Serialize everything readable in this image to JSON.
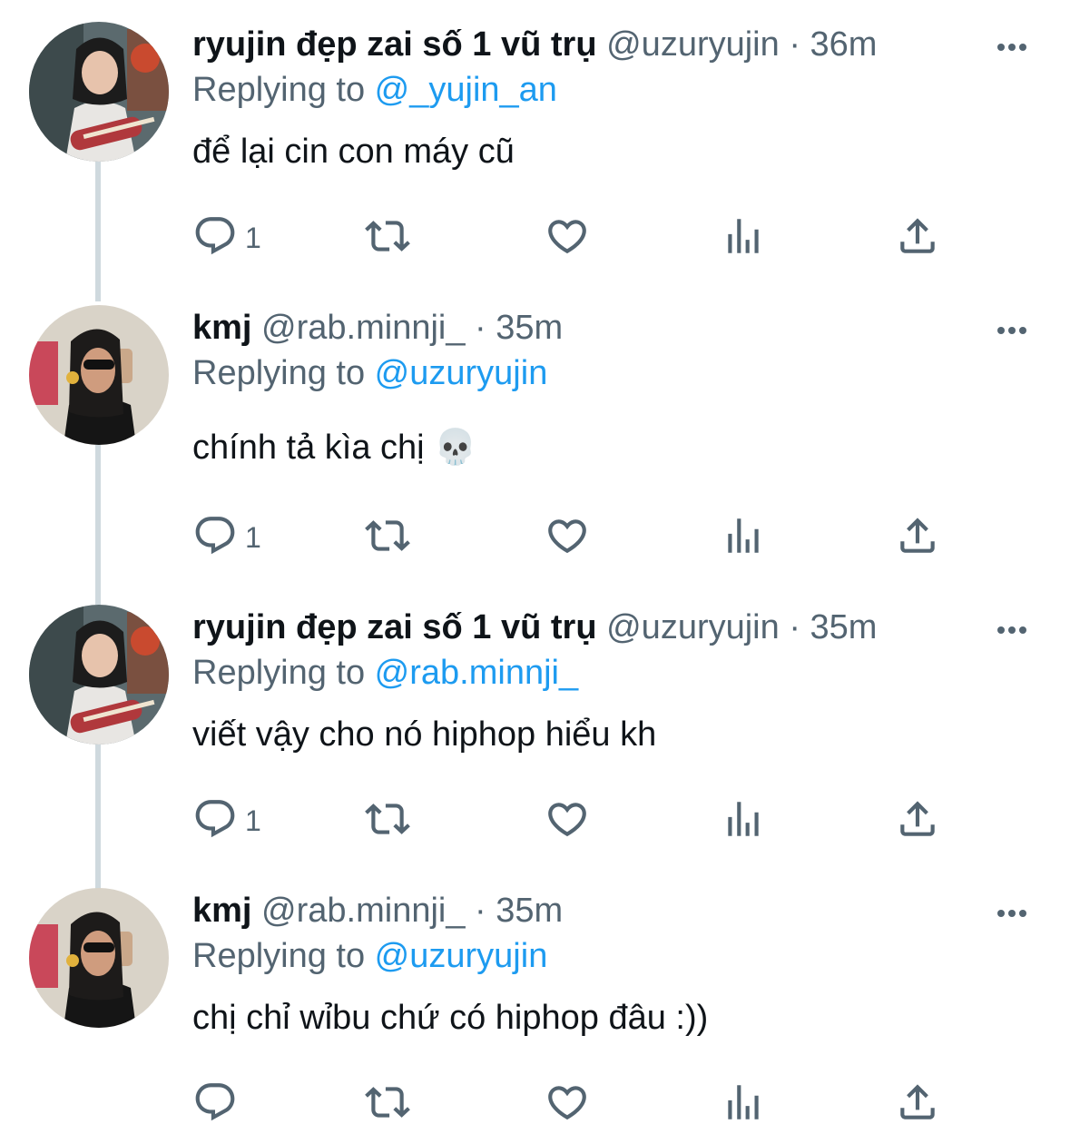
{
  "tweets": [
    {
      "name": "ryujin đẹp zai số 1 vũ trụ",
      "handle": "@uzuryujin",
      "time": "· 36m",
      "replying_prefix": "Replying to ",
      "replying_to": "@_yujin_an",
      "text": "để lại cin con máy cũ",
      "reply_count": "1",
      "avatar": "guitar-girl-avatar"
    },
    {
      "name": "kmj",
      "handle": "@rab.minnji_",
      "time": "· 35m",
      "replying_prefix": "Replying to ",
      "replying_to": "@uzuryujin",
      "text": "chính tả kìa chị 💀",
      "reply_count": "1",
      "avatar": "selfie-girl-avatar"
    },
    {
      "name": "ryujin đẹp zai số 1 vũ trụ",
      "handle": "@uzuryujin",
      "time": "· 35m",
      "replying_prefix": "Replying to ",
      "replying_to": "@rab.minnji_",
      "text": "viết vậy cho nó hiphop hiểu kh",
      "reply_count": "1",
      "avatar": "guitar-girl-avatar"
    },
    {
      "name": "kmj",
      "handle": "@rab.minnji_",
      "time": "· 35m",
      "replying_prefix": "Replying to ",
      "replying_to": "@uzuryujin",
      "text": "chị chỉ wỉbu chứ có hiphop đâu :))",
      "reply_count": "",
      "avatar": "selfie-girl-avatar"
    }
  ],
  "colors": {
    "link": "#1d9bf0",
    "secondary": "#536471",
    "thread_line": "#cfd9de"
  }
}
